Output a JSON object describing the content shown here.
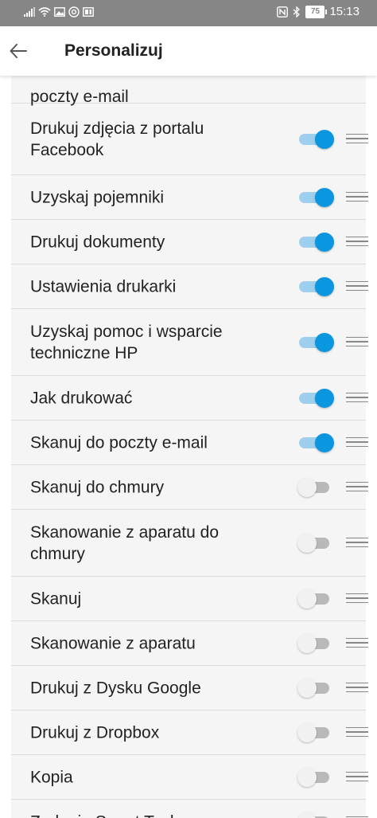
{
  "status_bar": {
    "icons": [
      "signal-icon",
      "wifi-icon",
      "image-notification-icon",
      "at-sign-icon",
      "news-icon"
    ],
    "right_icons": [
      "nfc-icon",
      "bluetooth-icon"
    ],
    "battery": "75",
    "time": "15:13"
  },
  "app_bar": {
    "back_icon": "arrow-left-icon",
    "title": "Personalizuj"
  },
  "items": [
    {
      "label": "poczty e-mail",
      "enabled": null,
      "height": 34,
      "partial": true
    },
    {
      "label": "Drukuj zdjęcia z portalu Facebook",
      "enabled": true,
      "height": 89
    },
    {
      "label": "Uzyskaj pojemniki",
      "enabled": true,
      "height": 55
    },
    {
      "label": "Drukuj dokumenty",
      "enabled": true,
      "height": 55
    },
    {
      "label": "Ustawienia drukarki",
      "enabled": true,
      "height": 55
    },
    {
      "label": "Uzyskaj pomoc i wsparcie techniczne HP",
      "enabled": true,
      "height": 83
    },
    {
      "label": "Jak drukować",
      "enabled": true,
      "height": 55
    },
    {
      "label": "Skanuj do poczty e-mail",
      "enabled": true,
      "height": 55
    },
    {
      "label": "Skanuj do chmury",
      "enabled": false,
      "height": 55
    },
    {
      "label": "Skanowanie z aparatu do chmury",
      "enabled": false,
      "height": 83
    },
    {
      "label": "Skanuj",
      "enabled": false,
      "height": 55
    },
    {
      "label": "Skanowanie z aparatu",
      "enabled": false,
      "height": 55
    },
    {
      "label": "Drukuj z Dysku Google",
      "enabled": false,
      "height": 55
    },
    {
      "label": "Drukuj z Dropbox",
      "enabled": false,
      "height": 55
    },
    {
      "label": "Kopia",
      "enabled": false,
      "height": 55
    },
    {
      "label": "Zadania Smart Tasks",
      "enabled": false,
      "height": 55
    }
  ],
  "colors": {
    "accent": "#0b96e0",
    "accent_track": "#9fcfee",
    "status_bar": "#868686"
  }
}
